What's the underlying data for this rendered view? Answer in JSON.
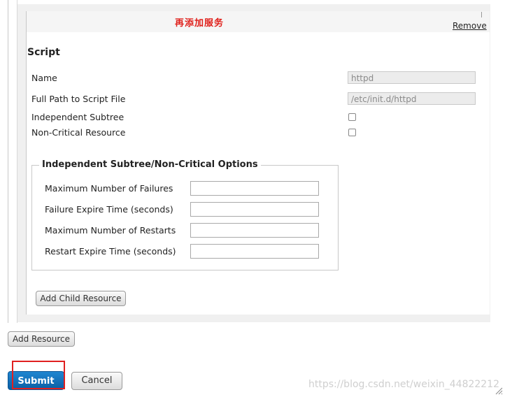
{
  "annotation": "再添加服务",
  "remove_link": "Remove",
  "script_section": {
    "title": "Script",
    "fields": [
      {
        "label": "Name",
        "value": "httpd"
      },
      {
        "label": "Full Path to Script File",
        "value": "/etc/init.d/httpd"
      }
    ],
    "checkboxes": [
      {
        "label": "Independent Subtree",
        "checked": false
      },
      {
        "label": "Non-Critical Resource",
        "checked": false
      }
    ]
  },
  "options": {
    "legend": "Independent Subtree/Non-Critical Options",
    "fields": [
      {
        "label": "Maximum Number of Failures",
        "value": ""
      },
      {
        "label": "Failure Expire Time (seconds)",
        "value": ""
      },
      {
        "label": "Maximum Number of Restarts",
        "value": ""
      },
      {
        "label": "Restart Expire Time (seconds)",
        "value": ""
      }
    ]
  },
  "buttons": {
    "add_child_resource": "Add Child Resource",
    "add_resource": "Add Resource",
    "submit": "Submit",
    "cancel": "Cancel"
  },
  "watermark": "https://blog.csdn.net/weixin_44822212",
  "colors": {
    "submit_bg": "#0b6cb8",
    "annotation_red": "#e0201b",
    "highlight_box": "#e02020"
  }
}
